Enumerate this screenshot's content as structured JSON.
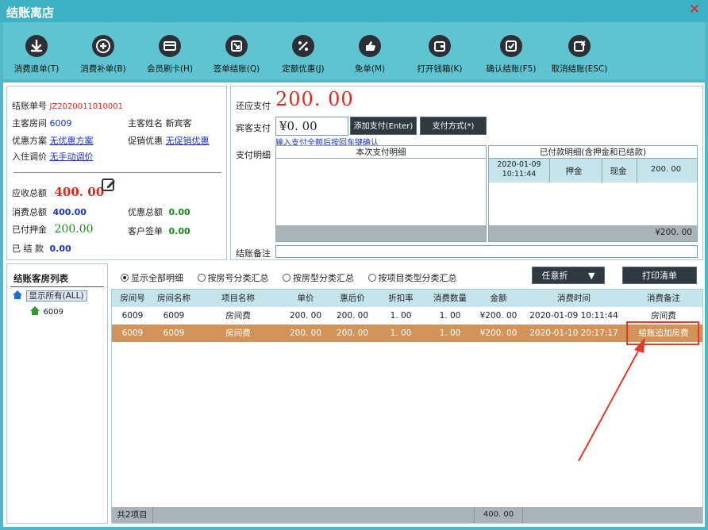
{
  "window": {
    "title": "结账离店",
    "close_glyph": "✕"
  },
  "toolbar": {
    "items": [
      {
        "label": "消费退单(T)",
        "icon": "download-circle-icon"
      },
      {
        "label": "消费补单(B)",
        "icon": "plus-circle-icon"
      },
      {
        "label": "会员刷卡(H)",
        "icon": "card-icon"
      },
      {
        "label": "签单结账(Q)",
        "icon": "sign-icon"
      },
      {
        "label": "定额优惠(J)",
        "icon": "percent-icon"
      },
      {
        "label": "免单(M)",
        "icon": "thumbs-up-icon"
      },
      {
        "label": "打开钱箱(K)",
        "icon": "wallet-icon"
      },
      {
        "label": "确认结账(F5)",
        "icon": "check-square-icon"
      },
      {
        "label": "取消结账(ESC)",
        "icon": "cancel-square-icon"
      }
    ]
  },
  "summary": {
    "bill_no_label": "结账单号",
    "bill_no": "JZ2020011010001",
    "room_label": "主客房间",
    "room": "6009",
    "guest_label": "主客姓名",
    "guest": "新宾客",
    "discount_plan_label": "优惠方案",
    "discount_plan": "无优惠方案",
    "promo_label": "促销优惠",
    "promo": "无促销优惠",
    "checkin_adjust_label": "入住调价",
    "checkin_adjust": "无手动调价",
    "receivable_label": "应收总额",
    "receivable": "400. 00",
    "consumed_label": "消费总额",
    "consumed": "400.00",
    "discount_total_label": "优惠总额",
    "discount_total": "0.00",
    "deposit_label": "已付押金",
    "deposit": "200.00",
    "sign_label": "客户签单",
    "sign": "0.00",
    "settled_label": "已 结 款",
    "settled": "0.00"
  },
  "payment": {
    "due_label": "还应支付",
    "due": "200. 00",
    "guest_pay_label": "宾客支付",
    "guest_pay": "¥0. 00",
    "add_btn": "添加支付(Enter)",
    "method_btn": "支付方式(*)",
    "hint": "输入支付全额后按回车键确认",
    "detail_label": "支付明细",
    "current_header": "本次支付明细",
    "paid_header": "已付款明细(含押金和已结款)",
    "paid_row": {
      "time": "2020-01-09 10:11:44",
      "type": "押金",
      "method": "现金",
      "amount": "200. 00"
    },
    "paid_total": "¥200. 00",
    "remark_label": "结账备注"
  },
  "rooms": {
    "header": "结账客房列表",
    "all": "显示所有(ALL)",
    "items": [
      "6009"
    ]
  },
  "filters": {
    "options": [
      "显示全部明细",
      "按房号分类汇总",
      "按房型分类汇总",
      "按项目类型分类汇总"
    ],
    "selected": 0,
    "any_discount": "任意折",
    "print_btn": "打印清单"
  },
  "table": {
    "columns": [
      "房间号",
      "房间名称",
      "项目名称",
      "单价",
      "惠后价",
      "折扣率",
      "消费数量",
      "金额",
      "消费时间",
      "消费备注"
    ],
    "rows": [
      [
        "6009",
        "6009",
        "房间费",
        "200. 00",
        "200. 00",
        "1. 00",
        "1. 00",
        "¥200. 00",
        "2020-01-09 10:11:44",
        "房间费"
      ],
      [
        "6009",
        "6009",
        "房间费",
        "200. 00",
        "200. 00",
        "1. 00",
        "1. 00",
        "¥200. 00",
        "2020-01-10 20:17:17",
        "结账追加房费"
      ]
    ],
    "selected_row": 1,
    "footer_count": "共2项目",
    "footer_total": "400. 00"
  },
  "colors": {
    "accent": "#3cb2c4",
    "selected_row": "#d2935a",
    "annotation": "#e23a2b"
  }
}
